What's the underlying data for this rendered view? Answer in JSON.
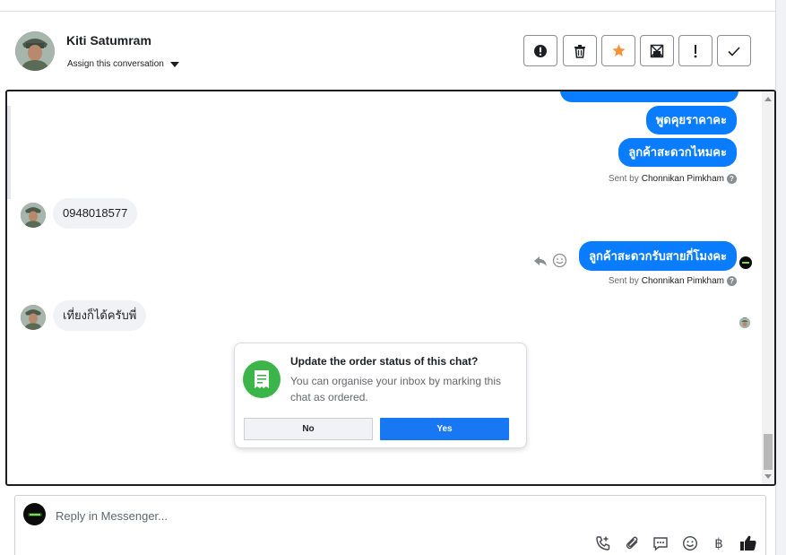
{
  "header": {
    "contact_name": "Kiti Satumram",
    "assign_label": "Assign this conversation",
    "actions": [
      {
        "icon": "alert-circle-icon",
        "name": "spam-button"
      },
      {
        "icon": "trash-icon",
        "name": "delete-button"
      },
      {
        "icon": "star-icon",
        "name": "star-button"
      },
      {
        "icon": "mark-unread-icon",
        "name": "mark-unread-button"
      },
      {
        "icon": "exclamation-icon",
        "name": "follow-up-button"
      },
      {
        "icon": "check-icon",
        "name": "done-button"
      }
    ],
    "star_color": "#f7923b"
  },
  "conversation": {
    "messages_out_top": [
      {
        "text": "พูดคุยราคาคะ"
      },
      {
        "text": "ลูกค้าสะดวกไหมคะ"
      }
    ],
    "sent_by_1": {
      "prefix": "Sent by",
      "name": "Chonnikan Pimkham"
    },
    "incoming_1": "0948018577",
    "message_out_2": "ลูกค้าสะดวกรับสายกี่โมงคะ",
    "sent_by_2": {
      "prefix": "Sent by",
      "name": "Chonnikan Pimkham"
    },
    "incoming_2": "เที่ยงก็ได้ครับพี่",
    "accent_color": "#0a7cff"
  },
  "order_prompt": {
    "title": "Update the order status of this chat?",
    "description": "You can organise your inbox by marking this chat as ordered.",
    "no_label": "No",
    "yes_label": "Yes",
    "icon": "receipt-icon",
    "icon_color": "#3bb54a"
  },
  "reply": {
    "placeholder": "Reply in Messenger...",
    "tools": [
      "phone-plus-icon",
      "attachment-icon",
      "saved-replies-icon",
      "emoji-icon",
      "baht-icon",
      "thumbs-up-icon"
    ],
    "baht_symbol": "฿"
  }
}
